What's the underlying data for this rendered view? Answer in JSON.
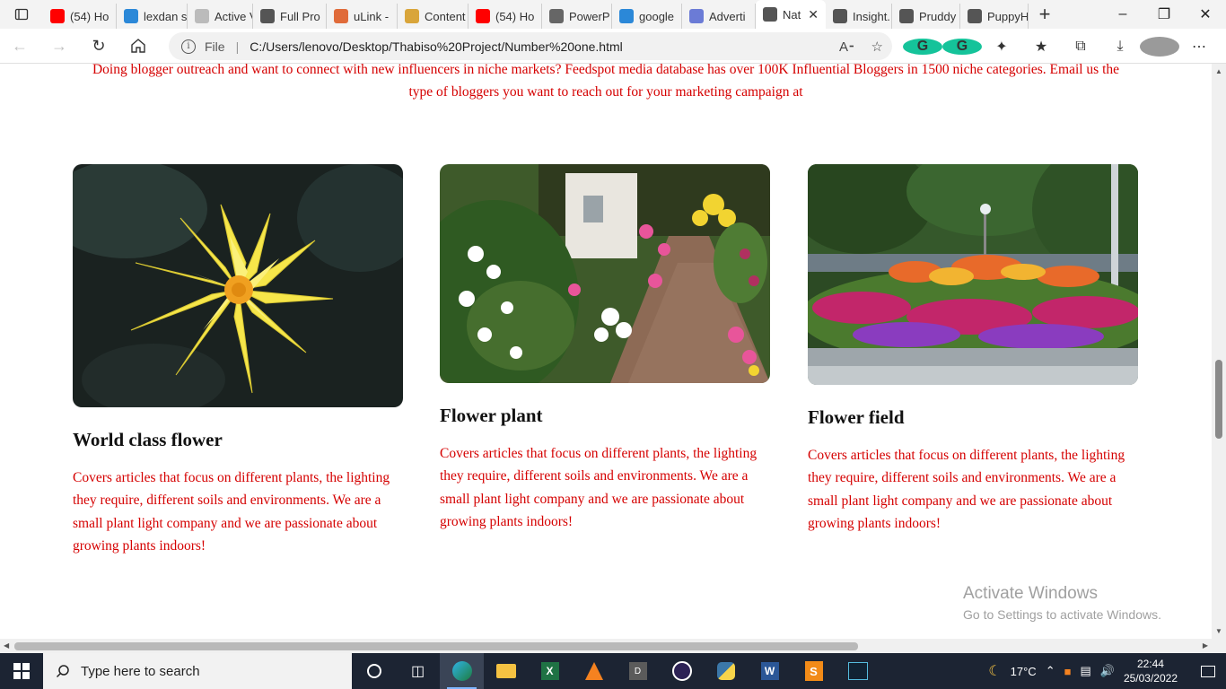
{
  "browser": {
    "tabs": [
      {
        "label": "(54) Ho",
        "icon": "youtube-icon",
        "color": "#ff0000"
      },
      {
        "label": "lexdan s",
        "icon": "bing-icon",
        "color": "#2b88d8"
      },
      {
        "label": "Active V",
        "icon": "generic-icon",
        "color": "#bbbbbb"
      },
      {
        "label": "Full Pro",
        "icon": "page-icon",
        "color": "#555555"
      },
      {
        "label": "uLink -",
        "icon": "ulink-icon",
        "color": "#e06b3a"
      },
      {
        "label": "Content",
        "icon": "content-icon",
        "color": "#d9a53a"
      },
      {
        "label": "(54) Ho",
        "icon": "youtube-icon",
        "color": "#ff0000"
      },
      {
        "label": "PowerP",
        "icon": "bb-icon",
        "color": "#666666"
      },
      {
        "label": "google",
        "icon": "bing-icon",
        "color": "#2b88d8"
      },
      {
        "label": "Adverti",
        "icon": "check-icon",
        "color": "#6b7bd6"
      },
      {
        "label": "Nat",
        "icon": "page-icon",
        "color": "#555555",
        "active": true
      },
      {
        "label": "Insight.",
        "icon": "page-icon",
        "color": "#555555"
      },
      {
        "label": "Pruddy",
        "icon": "page-icon",
        "color": "#555555"
      },
      {
        "label": "PuppyH",
        "icon": "page-icon",
        "color": "#555555"
      }
    ],
    "address": {
      "scheme": "File",
      "url": "C:/Users/lenovo/Desktop/Thabiso%20Project/Number%20one.html"
    }
  },
  "page": {
    "intro": "Doing blogger outreach and want to connect with new influencers in niche markets? Feedspot media database has over 100K Influential Bloggers in 1500 niche categories. Email us the type of bloggers you want to reach out for your marketing campaign at",
    "cards": [
      {
        "title": "World class flower",
        "text": "Covers articles that focus on different plants, the lighting they require, different soils and environments. We are a small plant light company and we are passionate about growing plants indoors!",
        "image": "yellow-water-lily-photo"
      },
      {
        "title": "Flower plant",
        "text": "Covers articles that focus on different plants, the lighting they require, different soils and environments. We are a small plant light company and we are passionate about growing plants indoors!",
        "image": "garden-path-flowers-photo"
      },
      {
        "title": "Flower field",
        "text": "Covers articles that focus on different plants, the lighting they require, different soils and environments. We are a small plant light company and we are passionate about growing plants indoors!",
        "image": "flower-bed-park-photo"
      }
    ],
    "watermark": {
      "title": "Activate Windows",
      "subtitle": "Go to Settings to activate Windows."
    }
  },
  "taskbar": {
    "search_placeholder": "Type here to search",
    "weather": "17°C",
    "time": "22:44",
    "date": "25/03/2022",
    "pinned": [
      "cortana-icon",
      "task-view-icon",
      "edge-icon",
      "file-explorer-icon",
      "excel-icon",
      "vlc-icon",
      "dictionary-icon",
      "eclipse-icon",
      "python-icon",
      "word-icon",
      "sublime-icon",
      "terminal-icon"
    ]
  }
}
